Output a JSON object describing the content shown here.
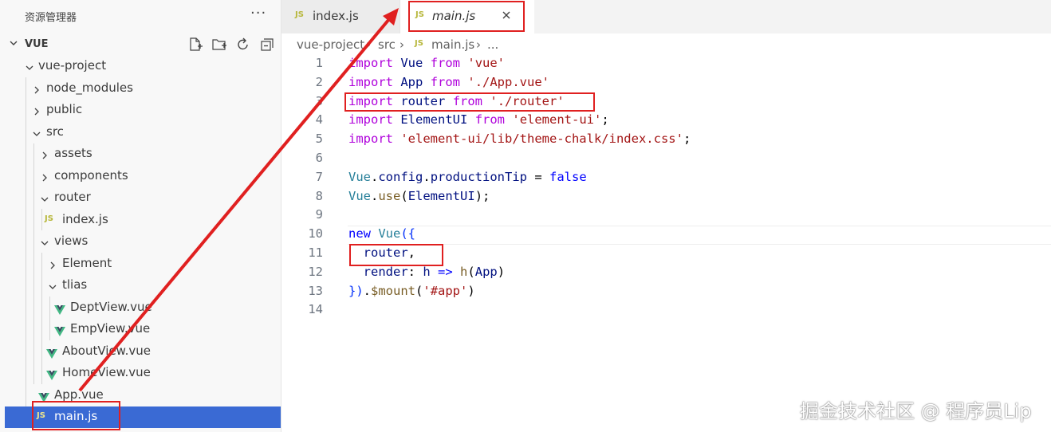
{
  "explorer": {
    "title": "资源管理器",
    "more": "···",
    "section": "VUE",
    "actions": [
      "new-file-icon",
      "new-folder-icon",
      "refresh-icon",
      "collapse-all-icon"
    ],
    "tree": [
      {
        "label": "vue-project",
        "type": "folder",
        "expanded": true
      },
      {
        "label": "node_modules",
        "type": "folder",
        "expanded": false
      },
      {
        "label": "public",
        "type": "folder",
        "expanded": false
      },
      {
        "label": "src",
        "type": "folder",
        "expanded": true
      },
      {
        "label": "assets",
        "type": "folder",
        "expanded": false
      },
      {
        "label": "components",
        "type": "folder",
        "expanded": false
      },
      {
        "label": "router",
        "type": "folder",
        "expanded": true
      },
      {
        "label": "index.js",
        "type": "js"
      },
      {
        "label": "views",
        "type": "folder",
        "expanded": true
      },
      {
        "label": "Element",
        "type": "folder",
        "expanded": false
      },
      {
        "label": "tlias",
        "type": "folder",
        "expanded": true
      },
      {
        "label": "DeptView.vue",
        "type": "vue"
      },
      {
        "label": "EmpView.vue",
        "type": "vue"
      },
      {
        "label": "AboutView.vue",
        "type": "vue"
      },
      {
        "label": "HomeView.vue",
        "type": "vue"
      },
      {
        "label": "App.vue",
        "type": "vue"
      },
      {
        "label": "main.js",
        "type": "js",
        "selected": true
      }
    ]
  },
  "tabs": [
    {
      "icon": "JS",
      "label": "index.js",
      "active": false
    },
    {
      "icon": "JS",
      "label": "main.js",
      "active": true,
      "close": "✕"
    }
  ],
  "breadcrumb": {
    "parts": [
      "vue-project",
      "src",
      "main.js",
      "..."
    ],
    "separator": "›",
    "file_icon": "JS"
  },
  "code": {
    "lines": [
      {
        "n": "1",
        "tokens": [
          [
            "kw",
            "import"
          ],
          [
            "pl",
            " "
          ],
          [
            "id",
            "Vue"
          ],
          [
            "pl",
            " "
          ],
          [
            "kw",
            "from"
          ],
          [
            "pl",
            " "
          ],
          [
            "st",
            "'vue'"
          ]
        ]
      },
      {
        "n": "2",
        "tokens": [
          [
            "kw",
            "import"
          ],
          [
            "pl",
            " "
          ],
          [
            "id",
            "App"
          ],
          [
            "pl",
            " "
          ],
          [
            "kw",
            "from"
          ],
          [
            "pl",
            " "
          ],
          [
            "st",
            "'./App.vue'"
          ]
        ]
      },
      {
        "n": "3",
        "tokens": [
          [
            "kw",
            "import"
          ],
          [
            "pl",
            " "
          ],
          [
            "id",
            "router"
          ],
          [
            "pl",
            " "
          ],
          [
            "kw",
            "from"
          ],
          [
            "pl",
            " "
          ],
          [
            "st",
            "'./router'"
          ]
        ]
      },
      {
        "n": "4",
        "tokens": [
          [
            "kw",
            "import"
          ],
          [
            "pl",
            " "
          ],
          [
            "id",
            "ElementUI"
          ],
          [
            "pl",
            " "
          ],
          [
            "kw",
            "from"
          ],
          [
            "pl",
            " "
          ],
          [
            "st",
            "'element-ui'"
          ],
          [
            "pl",
            ";"
          ]
        ]
      },
      {
        "n": "5",
        "tokens": [
          [
            "kw",
            "import"
          ],
          [
            "pl",
            " "
          ],
          [
            "st",
            "'element-ui/lib/theme-chalk/index.css'"
          ],
          [
            "pl",
            ";"
          ]
        ]
      },
      {
        "n": "6",
        "tokens": []
      },
      {
        "n": "7",
        "tokens": [
          [
            "ty",
            "Vue"
          ],
          [
            "pl",
            "."
          ],
          [
            "id",
            "config"
          ],
          [
            "pl",
            "."
          ],
          [
            "id",
            "productionTip"
          ],
          [
            "pl",
            " = "
          ],
          [
            "kb",
            "false"
          ]
        ]
      },
      {
        "n": "8",
        "tokens": [
          [
            "ty",
            "Vue"
          ],
          [
            "pl",
            "."
          ],
          [
            "fn",
            "use"
          ],
          [
            "pl",
            "("
          ],
          [
            "id",
            "ElementUI"
          ],
          [
            "pl",
            ");"
          ]
        ]
      },
      {
        "n": "9",
        "tokens": []
      },
      {
        "n": "10",
        "tokens": [
          [
            "kb",
            "new"
          ],
          [
            "pl",
            " "
          ],
          [
            "ty",
            "Vue"
          ],
          [
            "br",
            "({"
          ]
        ]
      },
      {
        "n": "11",
        "tokens": [
          [
            "pl",
            "  "
          ],
          [
            "id",
            "router"
          ],
          [
            "pl",
            ","
          ]
        ]
      },
      {
        "n": "12",
        "tokens": [
          [
            "pl",
            "  "
          ],
          [
            "id",
            "render"
          ],
          [
            "pl",
            ": "
          ],
          [
            "id",
            "h"
          ],
          [
            "pl",
            " "
          ],
          [
            "kb",
            "=>"
          ],
          [
            "pl",
            " "
          ],
          [
            "fn",
            "h"
          ],
          [
            "pl",
            "("
          ],
          [
            "id",
            "App"
          ],
          [
            "pl",
            ")"
          ]
        ]
      },
      {
        "n": "13",
        "tokens": [
          [
            "br",
            "})"
          ],
          [
            "pl",
            "."
          ],
          [
            "fn",
            "$mount"
          ],
          [
            "pl",
            "("
          ],
          [
            "st",
            "'#app'"
          ],
          [
            "pl",
            ")"
          ]
        ]
      },
      {
        "n": "14",
        "tokens": []
      }
    ]
  },
  "colors": {
    "selection": "#3a6ad4",
    "annotation": "#e02020",
    "js_icon": "#b7b73b",
    "vue_icon": "#41b883"
  },
  "watermark": "掘金技术社区 @ 程序员Lip"
}
